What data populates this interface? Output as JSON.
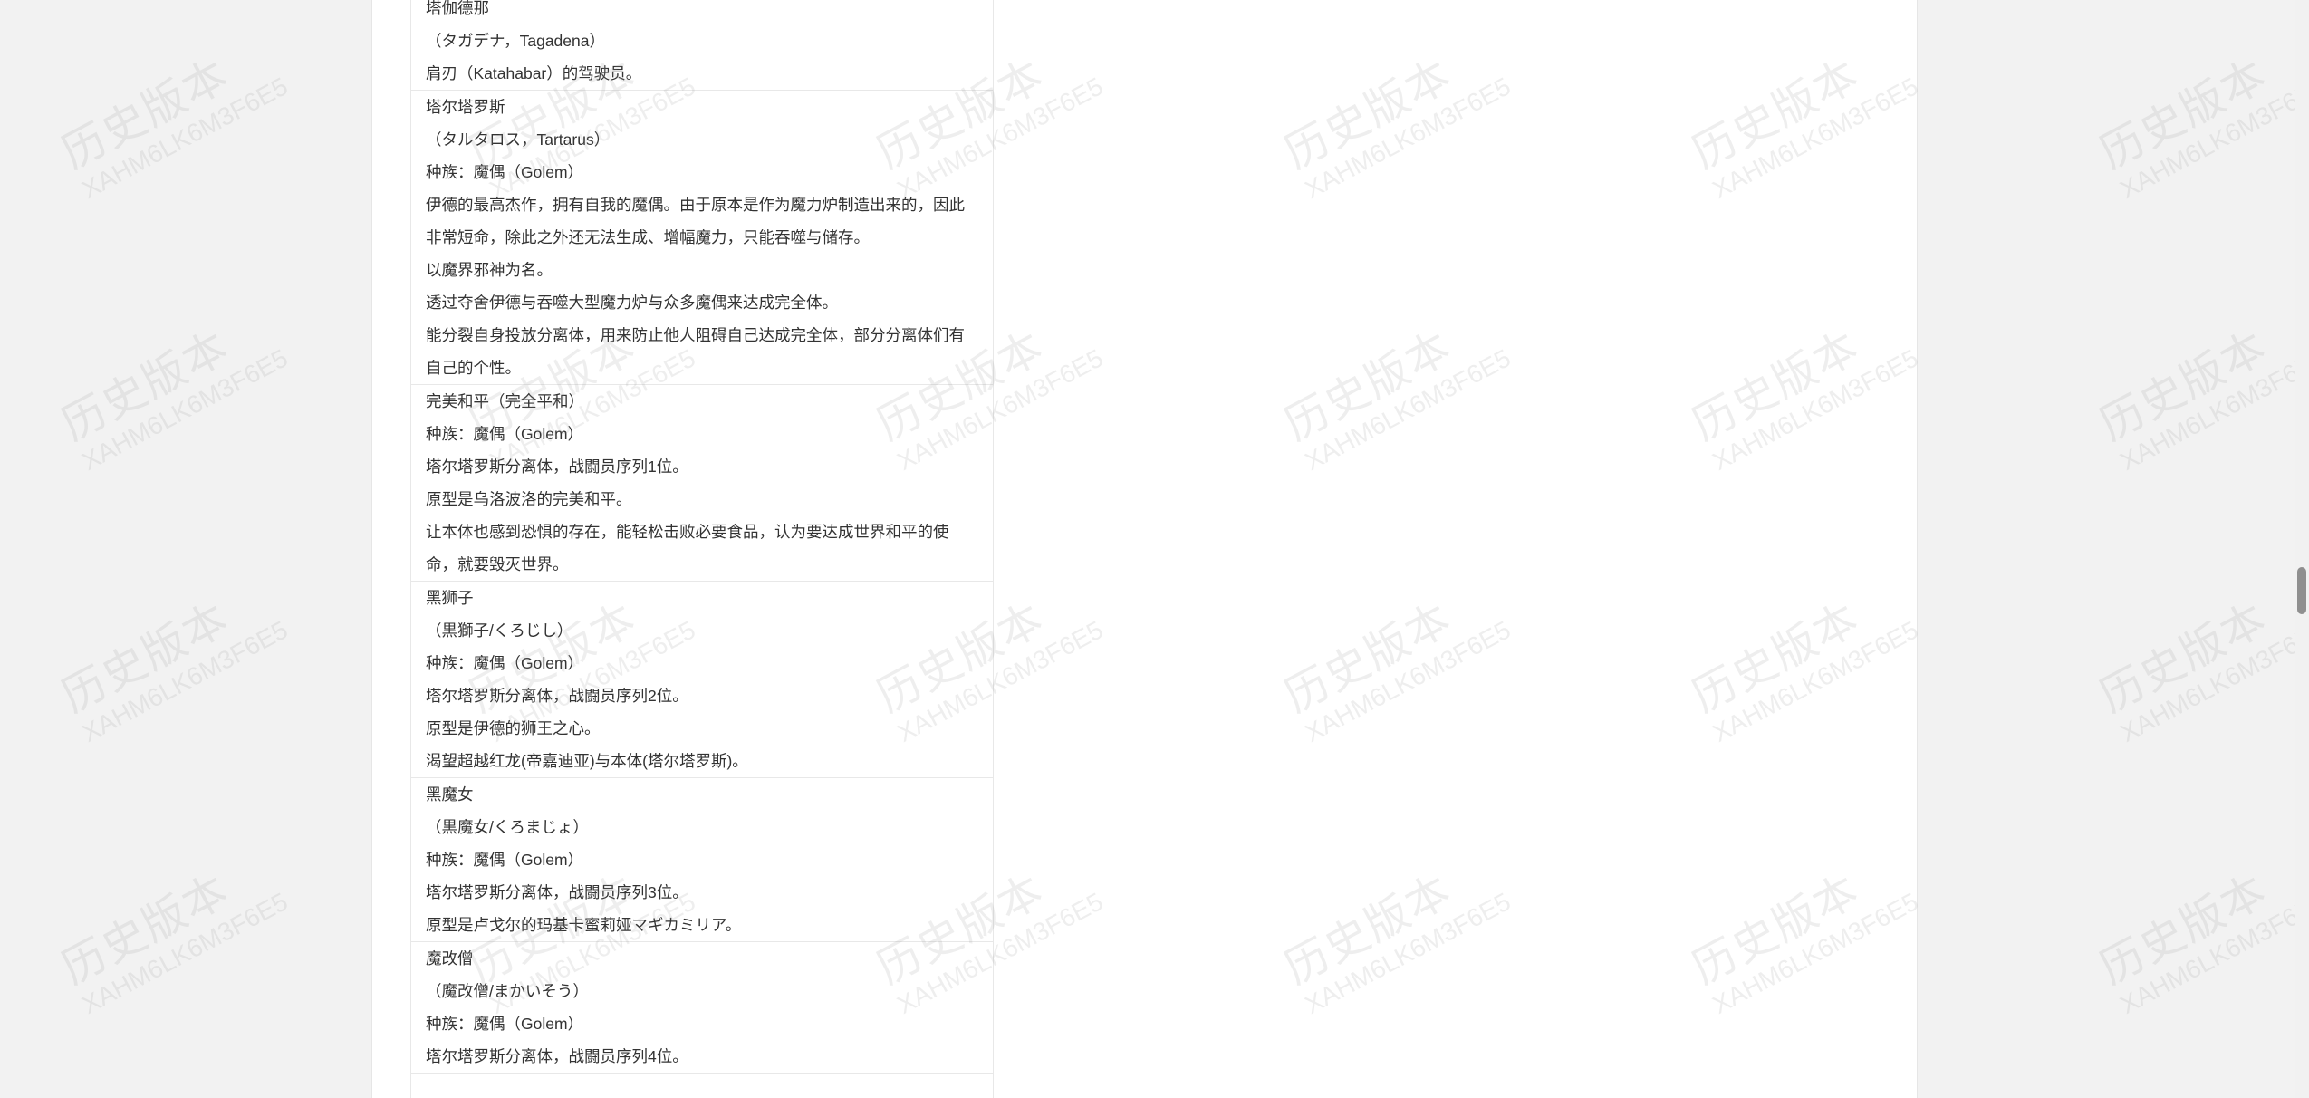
{
  "entries": [
    {
      "lines": [
        "塔伽德那",
        "（タガデナ，Tagadena）",
        "肩刃（Katahabar）的驾驶员。"
      ]
    },
    {
      "lines": [
        "塔尔塔罗斯",
        "（タルタロス，Tartarus）",
        "种族：魔偶（Golem）",
        "伊德的最高杰作，拥有自我的魔偶。由于原本是作为魔力炉制造出来的，因此非常短命，除此之外还无法生成、增幅魔力，只能吞噬与储存。",
        "以魔界邪神为名。",
        "透过夺舍伊德与吞噬大型魔力炉与众多魔偶来达成完全体。",
        "能分裂自身投放分离体，用来防止他人阻碍自己达成完全体，部分分离体们有自己的个性。"
      ]
    },
    {
      "lines": [
        "完美和平（完全平和）",
        "种族：魔偶（Golem）",
        "塔尔塔罗斯分离体，战闘员序列1位。",
        "原型是乌洛波洛的完美和平。",
        "让本体也感到恐惧的存在，能轻松击败必要食品，认为要达成世界和平的使命，就要毁灭世界。"
      ]
    },
    {
      "lines": [
        "黑狮子",
        "（黒獅子/くろじし）",
        "种族：魔偶（Golem）",
        "塔尔塔罗斯分离体，战闘员序列2位。",
        "原型是伊德的狮王之心。",
        "渴望超越红龙(帝嘉迪亚)与本体(塔尔塔罗斯)。"
      ]
    },
    {
      "lines": [
        "黑魔女",
        "（黒魔女/くろまじょ）",
        "种族：魔偶（Golem）",
        "塔尔塔罗斯分离体，战闘员序列3位。",
        "原型是卢戈尔的玛基卡蜜莉娅マギカミリア。"
      ]
    },
    {
      "lines": [
        "魔改僧",
        "（魔改僧/まかいそう）",
        "种族：魔偶（Golem）",
        "塔尔塔罗斯分离体，战闘员序列4位。"
      ]
    }
  ],
  "watermark": {
    "title": "历史版本",
    "code": "XAHM6LK6M3F6E5"
  },
  "scrollbar": {
    "scroll_position": 0.54
  }
}
